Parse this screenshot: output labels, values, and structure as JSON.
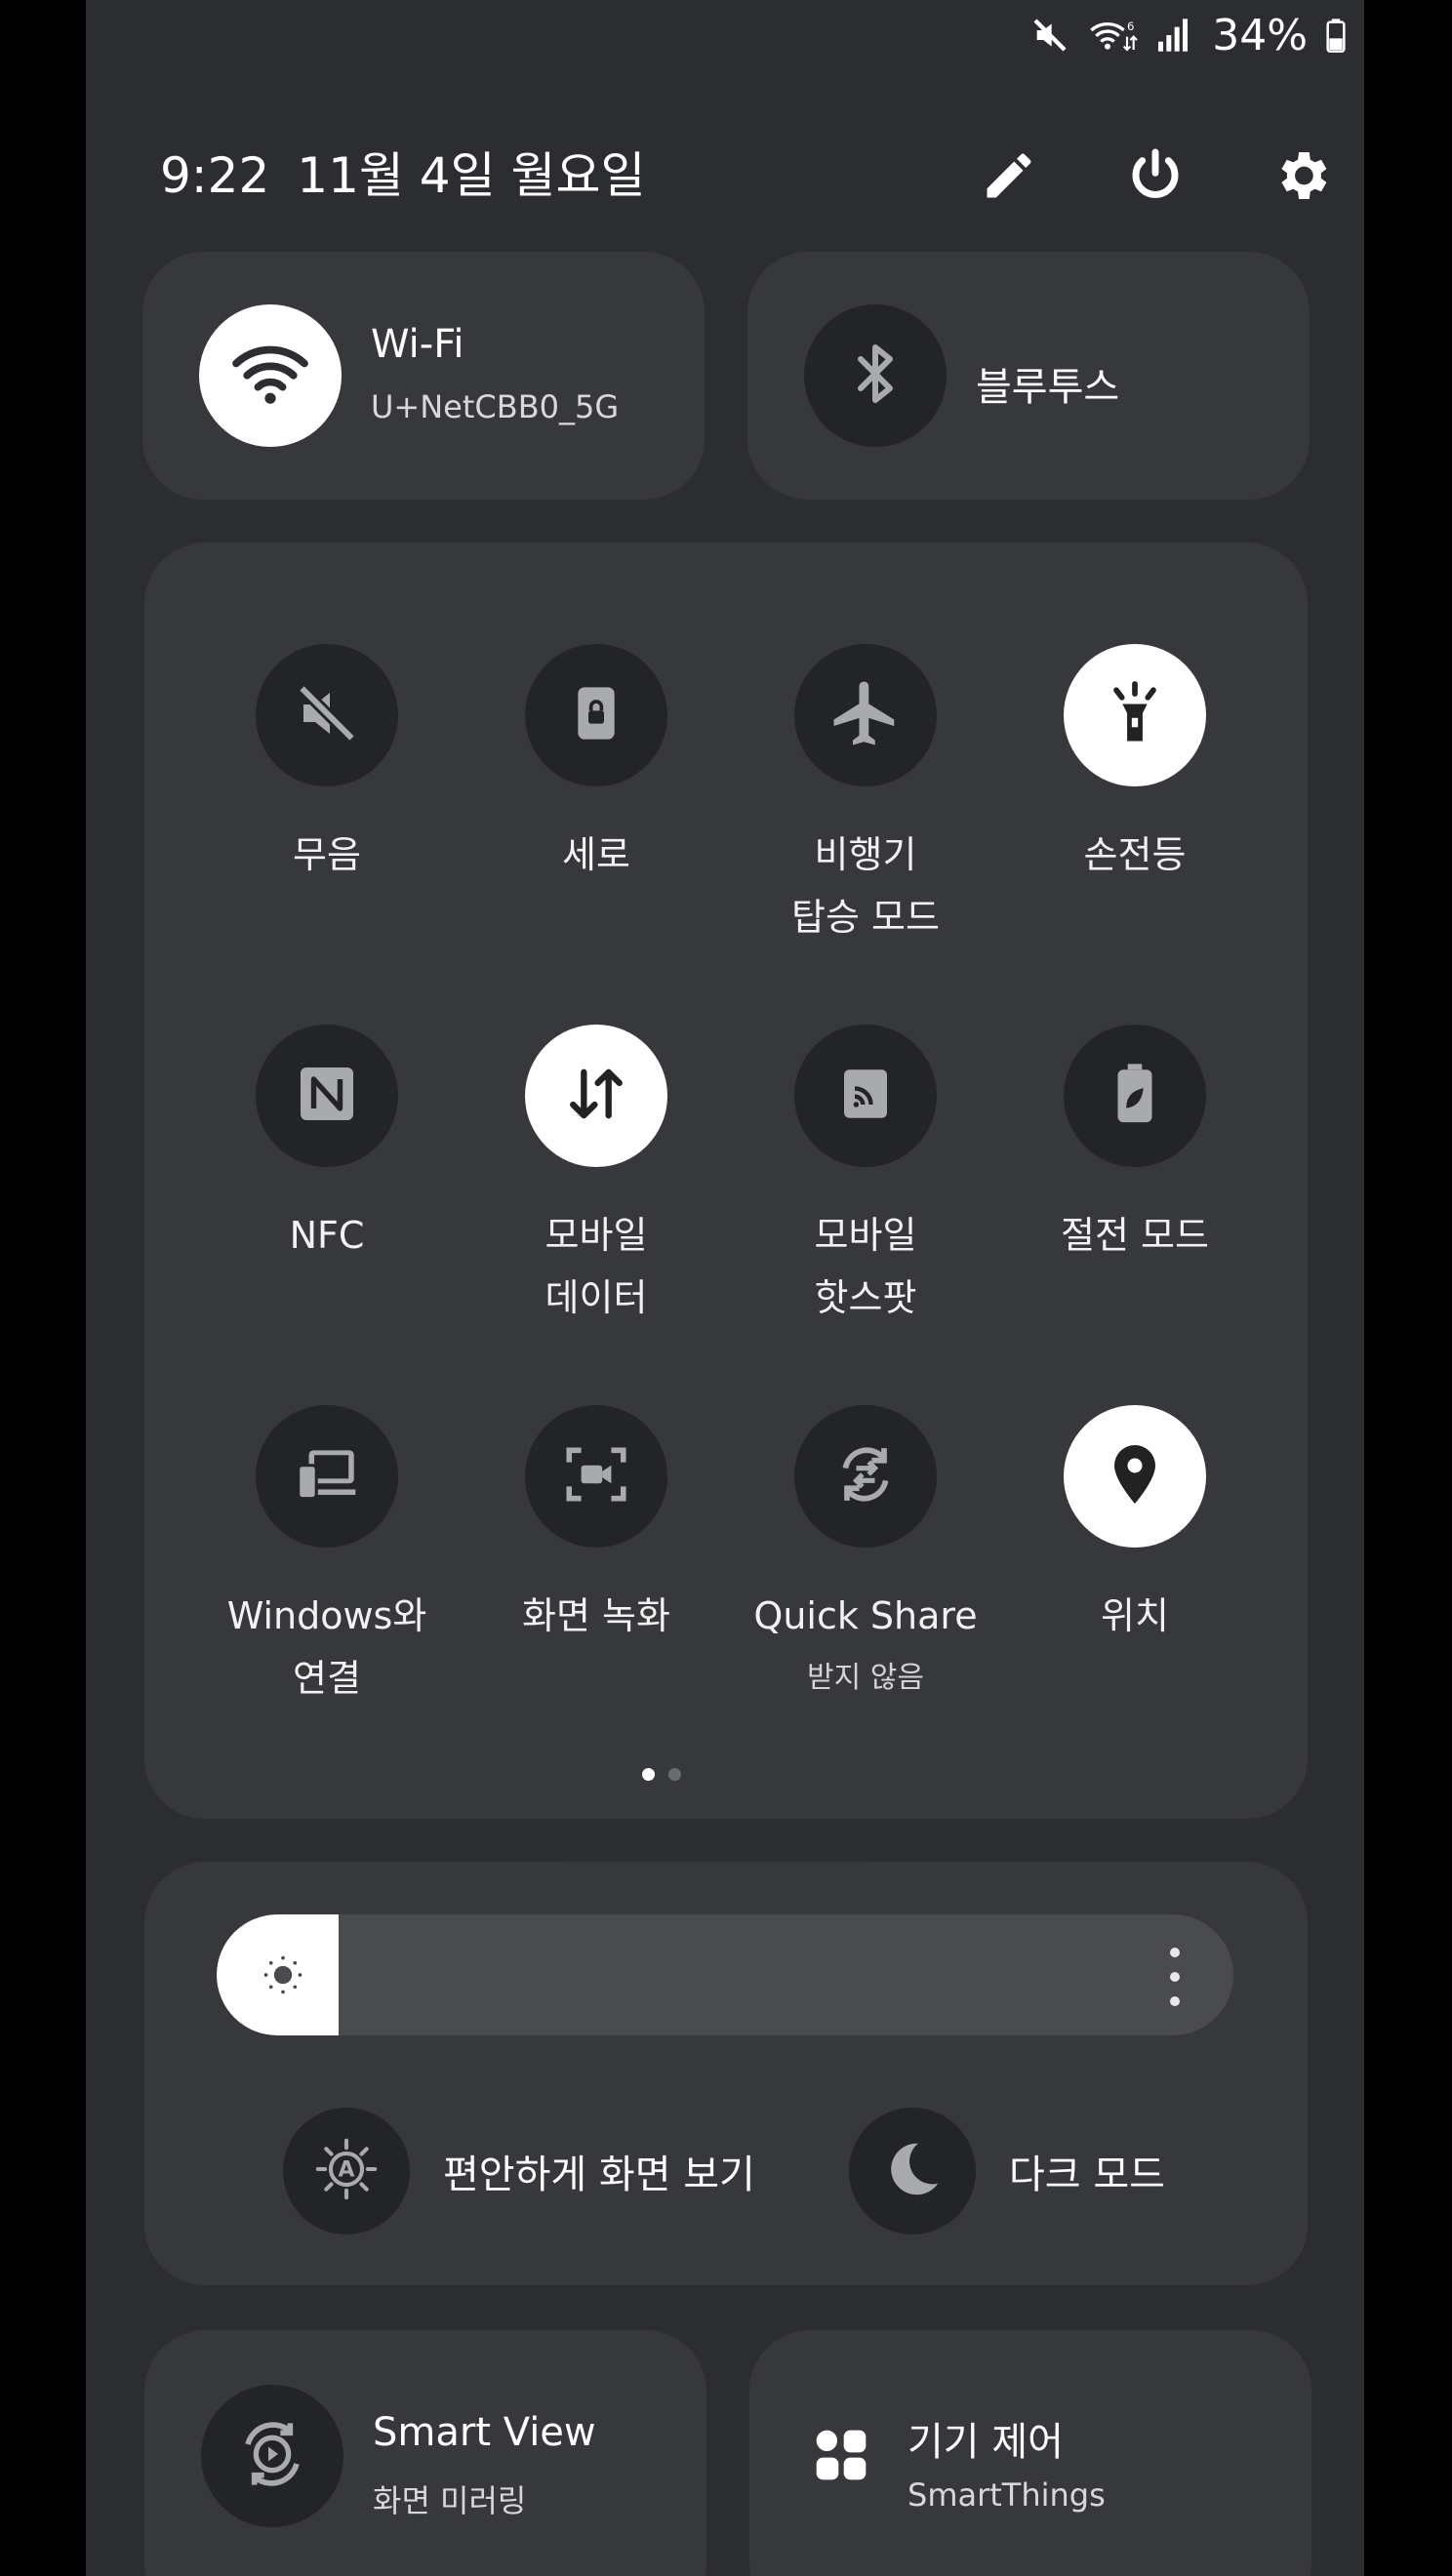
{
  "status_bar": {
    "battery": "34%",
    "icons": [
      "mute-icon",
      "wifi-signal-icon",
      "cellular-signal-icon",
      "battery-icon"
    ]
  },
  "header": {
    "time": "9:22",
    "date": "11월 4일 월요일",
    "icons": [
      "edit-pencil-icon",
      "power-icon",
      "settings-gear-icon"
    ]
  },
  "wifi": {
    "title": "Wi-Fi",
    "subtitle": "U+NetCBB0_5G",
    "state": "on"
  },
  "bluetooth": {
    "title": "블루투스",
    "state": "off"
  },
  "quick_tiles": [
    {
      "id": "mute",
      "label1": "무음",
      "label2": "",
      "icon": "mute-icon",
      "state": "off"
    },
    {
      "id": "portrait",
      "label1": "세로",
      "label2": "",
      "icon": "portrait-lock-icon",
      "state": "off"
    },
    {
      "id": "airplane",
      "label1": "비행기",
      "label2": "탑승 모드",
      "icon": "airplane-icon",
      "state": "off"
    },
    {
      "id": "flashlight",
      "label1": "손전등",
      "label2": "",
      "icon": "flashlight-icon",
      "state": "on"
    },
    {
      "id": "nfc",
      "label1": "NFC",
      "label2": "",
      "icon": "nfc-icon",
      "state": "off"
    },
    {
      "id": "mobile-data",
      "label1": "모바일",
      "label2": "데이터",
      "icon": "mobile-data-icon",
      "state": "on"
    },
    {
      "id": "hotspot",
      "label1": "모바일",
      "label2": "핫스팟",
      "icon": "hotspot-icon",
      "state": "off"
    },
    {
      "id": "power-saving",
      "label1": "절전 모드",
      "label2": "",
      "icon": "power-saving-icon",
      "state": "off"
    },
    {
      "id": "link-windows",
      "label1": "Windows와",
      "label2": "연결",
      "icon": "link-to-windows-icon",
      "state": "off"
    },
    {
      "id": "screen-recorder",
      "label1": "화면 녹화",
      "label2": "",
      "icon": "screen-recorder-icon",
      "state": "off"
    },
    {
      "id": "quick-share",
      "label1": "Quick Share",
      "label2": "",
      "sub": "받지 않음",
      "icon": "quick-share-icon",
      "state": "off"
    },
    {
      "id": "location",
      "label1": "위치",
      "label2": "",
      "icon": "location-pin-icon",
      "state": "on"
    }
  ],
  "page_indicator": {
    "pages": 2,
    "current": 1
  },
  "brightness": {
    "level": 0.12,
    "icon": "brightness-sun-icon",
    "more_icon": "more-vertical-icon"
  },
  "eye_comfort": {
    "label": "편안하게 화면 보기",
    "icon": "eye-comfort-icon"
  },
  "dark_mode": {
    "label": "다크 모드",
    "icon": "moon-icon"
  },
  "smart_view": {
    "title": "Smart View",
    "subtitle": "화면 미러링",
    "icon": "smart-view-icon"
  },
  "device_control": {
    "title": "기기 제어",
    "subtitle": "SmartThings",
    "icon": "device-grid-icon"
  }
}
